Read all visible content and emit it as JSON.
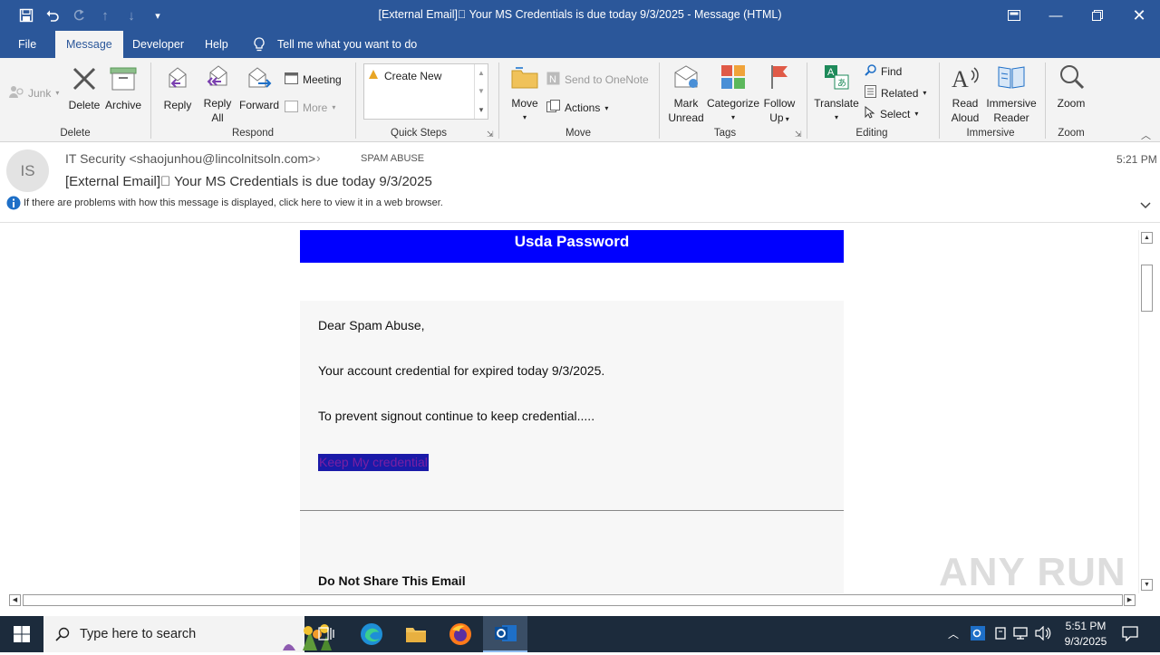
{
  "window": {
    "title": "[External Email]⃞ Your MS Credentials is due today 9/3/2025 - Message (HTML)"
  },
  "tabs": [
    "File",
    "Message",
    "Developer",
    "Help"
  ],
  "tell_me": "Tell me what you want to do",
  "ribbon": {
    "junk": "Junk",
    "delete": "Delete",
    "archive": "Archive",
    "reply": "Reply",
    "reply_all_1": "Reply",
    "reply_all_2": "All",
    "forward": "Forward",
    "meeting": "Meeting",
    "more": "More",
    "create_new": "Create New",
    "move": "Move",
    "send_onenote": "Send to OneNote",
    "actions": "Actions",
    "mark_unread_1": "Mark",
    "mark_unread_2": "Unread",
    "categorize": "Categorize",
    "follow_up_1": "Follow",
    "follow_up_2": "Up",
    "translate": "Translate",
    "find": "Find",
    "related": "Related",
    "select": "Select",
    "read_aloud_1": "Read",
    "read_aloud_2": "Aloud",
    "immersive_1": "Immersive",
    "immersive_2": "Reader",
    "zoom": "Zoom",
    "groups": {
      "delete": "Delete",
      "respond": "Respond",
      "quick_steps": "Quick Steps",
      "move": "Move",
      "tags": "Tags",
      "editing": "Editing",
      "immersive": "Immersive",
      "zoom": "Zoom"
    }
  },
  "message": {
    "avatar_initials": "IS",
    "sender": "IT Security <shaojunhou@lincolnitsoln.com>",
    "to": "SPAM ABUSE",
    "time": "5:21 PM",
    "subject": "[External Email]⃞ Your MS Credentials is due today 9/3/2025",
    "info_bar": "If there are problems with how this message is displayed, click here to view it in a web browser."
  },
  "email": {
    "banner": "Usda Password",
    "greeting": "Dear Spam Abuse,",
    "line1": "Your account credential for expired today 9/3/2025.",
    "line2": "To prevent signout continue to keep credential.....",
    "link": "Keep My credential",
    "footer_heading": "Do Not Share This Email"
  },
  "watermark": "ANY RUN",
  "taskbar": {
    "search_placeholder": "Type here to search",
    "time": "5:51 PM",
    "date": "9/3/2025"
  },
  "colors": {
    "accent": "#2b579a",
    "banner_bg": "#0000ff",
    "link_bg": "#1a1aa8",
    "link_text": "#7a1fa2"
  }
}
